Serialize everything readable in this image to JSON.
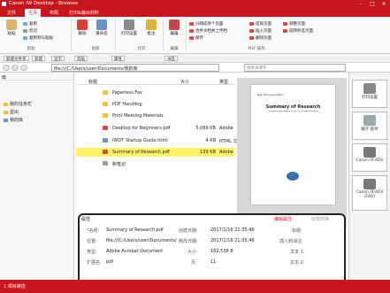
{
  "window": {
    "title": "Canon iW Desktop - Browser"
  },
  "tabs": [
    "文件",
    "主页",
    "布局",
    "打印&输出材料"
  ],
  "ribbon": {
    "paste": "粘贴",
    "clip": [
      "复制",
      "剪切",
      "复制到与粘贴"
    ],
    "clip_group": "剪贴",
    "delete": "删除",
    "rename": "重命名",
    "org_group": "组织",
    "print": "打印设置",
    "annot": "批注",
    "print_group": "打印",
    "edit": "编辑",
    "edit_group": "编辑",
    "pdf": [
      "分隔成单个页面",
      "合并文档并上传档",
      "保存"
    ],
    "pdf2": [
      "提取页面",
      "插入页面",
      "删除页面"
    ],
    "pdf3": [
      "调整页面",
      "旋转所选页面"
    ],
    "pdf_group": "PDF 操作"
  },
  "toolbar": {
    "b1": "新建文件夹",
    "b2": "新建",
    "b3": "显示",
    "b4": "剪贴",
    "b5": "属性",
    "b6": "书签"
  },
  "address": {
    "path": "file:///C:/Users/user/Documents/我的库",
    "search": "搜索关键字"
  },
  "tree": {
    "header": "库",
    "items": [
      "我的任务栏",
      "显出",
      "我的库"
    ]
  },
  "list": {
    "headers": {
      "name": "标题",
      "size": "大小",
      "type": "类型"
    },
    "rows": [
      {
        "name": "Paperless Fax",
        "size": "",
        "type": ""
      },
      {
        "name": "PDF Handling",
        "size": "",
        "type": ""
      },
      {
        "name": "Print Meeting Materials",
        "size": "",
        "type": ""
      },
      {
        "name": "Desktop for Beginners.pdf",
        "size": "5,069 KB",
        "type": "Adobe"
      },
      {
        "name": "iWDT Startup Guide.html",
        "size": "4 KB",
        "type": "HTML 文"
      },
      {
        "name": "Summary of Research.pdf",
        "size": "159 KB",
        "type": "Adobe"
      },
      {
        "name": "新笔记",
        "size": "",
        "type": ""
      }
    ]
  },
  "preview": {
    "doc_header": "Rev. 02 Corporation",
    "doc_title": "Summary of Research",
    "doc_sub": "The Project Development of 2016 TO RESEARCH REPORT",
    "page": "1",
    "pages": "/11"
  },
  "right": [
    "打印设置",
    "端子 部件",
    "Canon iR-ADV",
    "Canon iR-ADV (FAX)"
  ],
  "props": {
    "header": "属性",
    "edit": "编辑属性",
    "tag": "标签转换",
    "labels_l": [
      "*名称:",
      "位置:",
      "类型:",
      "扩展名:"
    ],
    "values_l": [
      "Summary of Research.pdf",
      "file:///C:/Users/user/Documents/",
      "Adobe Acrobat Document",
      "pdf"
    ],
    "labels_m": [
      "创建日期:",
      "修改日期:",
      "大小:",
      "页:"
    ],
    "values_m": [
      "2017/1/16 21:35:46",
      "2017/1/16 21:35:46",
      "162,538 B",
      "11"
    ],
    "labels_r": [
      "标题:",
      "插入到消注:",
      "文本 1:",
      "文本 2:"
    ]
  },
  "status": {
    "text": "1 项目被选"
  },
  "colors": {
    "brand": "#c8161d",
    "selected": "#fff36a",
    "folder": "#f0c040"
  }
}
